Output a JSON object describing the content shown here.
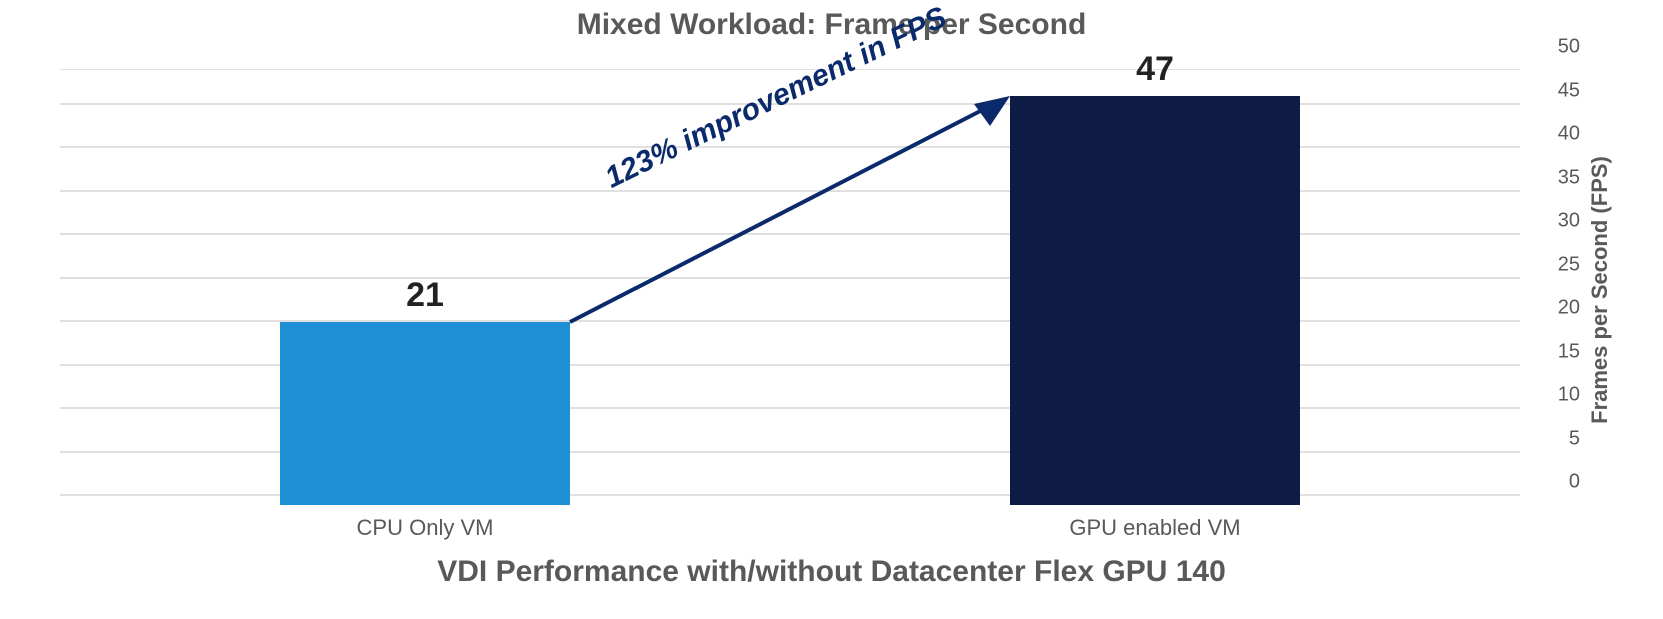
{
  "chart_data": {
    "type": "bar",
    "title": "Mixed Workload: Frame per Second",
    "subtitle": "VDI Performance with/without Datacenter Flex GPU 140",
    "categories": [
      "CPU Only VM",
      "GPU enabled VM"
    ],
    "values": [
      21,
      47
    ],
    "data_labels": [
      "21",
      "47"
    ],
    "ylabel": "Frames per Second (FPS)",
    "ylim": [
      0,
      50
    ],
    "yticks": [
      0,
      5,
      10,
      15,
      20,
      25,
      30,
      35,
      40,
      45,
      50
    ],
    "annotation": "123% improvement in FPS",
    "colors": [
      "#1f8fd6",
      "#0d1b45"
    ]
  }
}
